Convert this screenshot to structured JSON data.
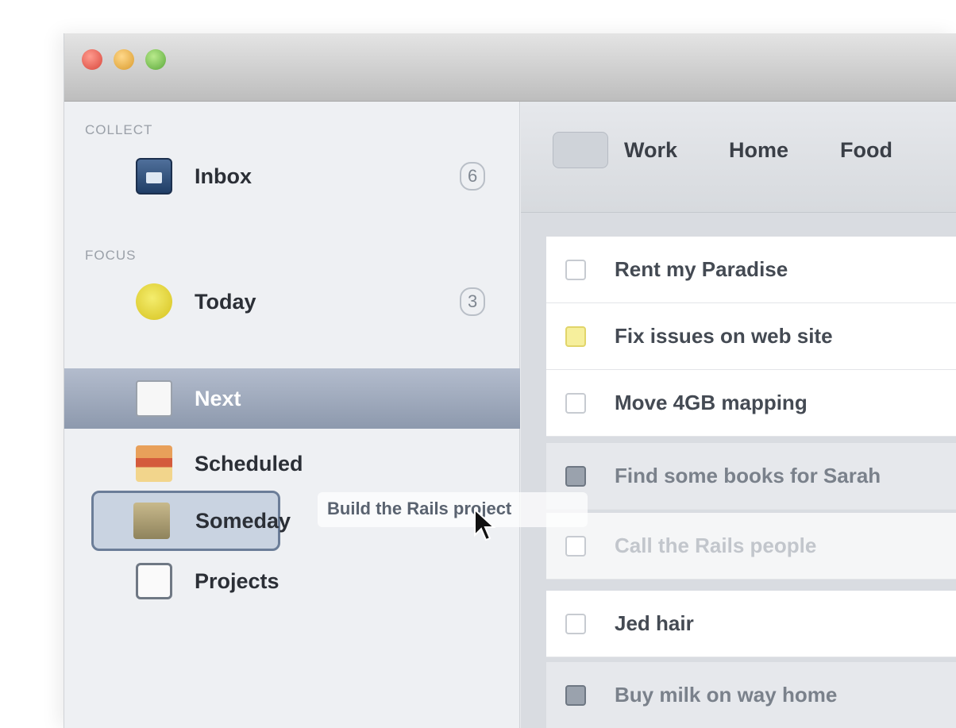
{
  "sidebar": {
    "section_collect": "COLLECT",
    "section_focus": "FOCUS",
    "items": [
      {
        "label": "Inbox",
        "count": "6"
      },
      {
        "label": "Today",
        "count": "3"
      },
      {
        "label": "Next"
      },
      {
        "label": "Scheduled"
      },
      {
        "label": "Someday"
      },
      {
        "label": "Projects"
      }
    ]
  },
  "drag": {
    "label": "Build the Rails project",
    "cursor_icon": "pointer-arrow-icon"
  },
  "tags": [
    "Work",
    "Home",
    "Food"
  ],
  "tasks": [
    {
      "title": "Rent my Paradise"
    },
    {
      "title": "Fix issues on web site"
    },
    {
      "title": "Move 4GB mapping"
    },
    {
      "title": "Find some books for Sarah"
    },
    {
      "title": "Call the Rails people"
    },
    {
      "title": "Jed hair"
    },
    {
      "title": "Buy milk on way home"
    }
  ],
  "colors": {
    "selected_row": "#8d99ad",
    "window_bg": "#e9ebee",
    "task_bg": "#ffffff"
  }
}
